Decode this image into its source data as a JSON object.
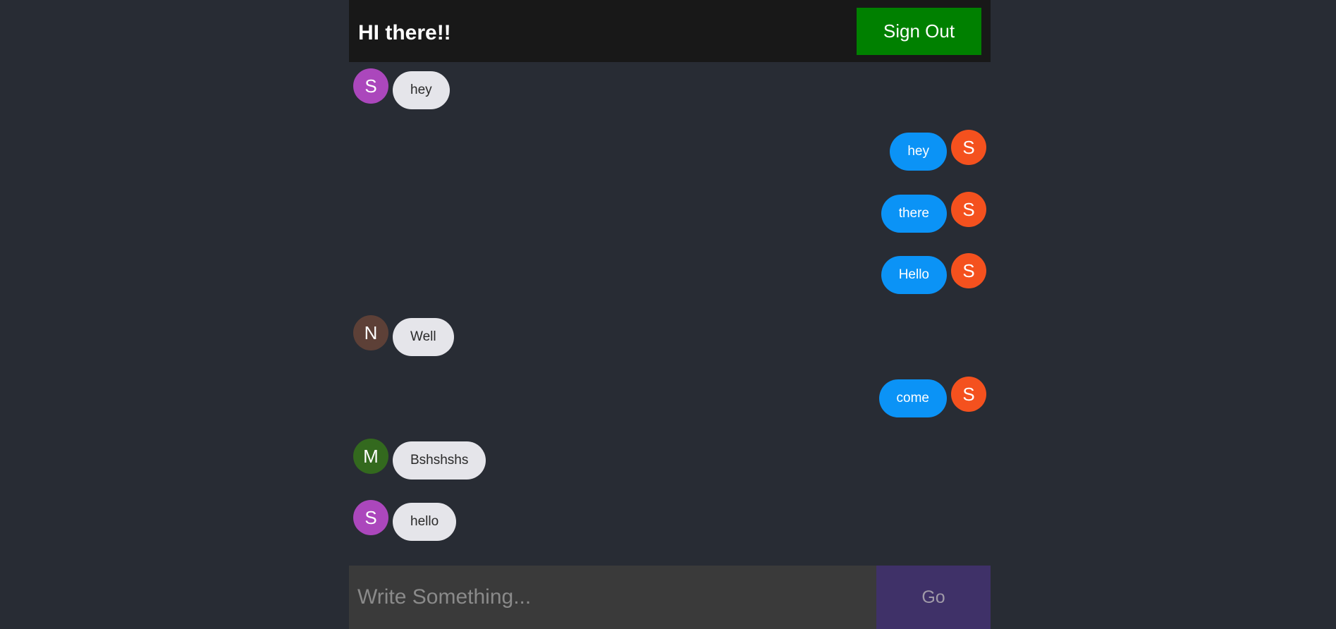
{
  "header": {
    "title": "HI there!!",
    "sign_out_label": "Sign Out"
  },
  "messages": [
    {
      "text": "hey",
      "initial": "S",
      "direction": "received",
      "avatar_color": "#ab47bc"
    },
    {
      "text": "hey",
      "initial": "S",
      "direction": "sent",
      "avatar_color": "#f4511e"
    },
    {
      "text": "there",
      "initial": "S",
      "direction": "sent",
      "avatar_color": "#f4511e"
    },
    {
      "text": "Hello",
      "initial": "S",
      "direction": "sent",
      "avatar_color": "#f4511e"
    },
    {
      "text": "Well",
      "initial": "N",
      "direction": "received",
      "avatar_color": "#5d4037"
    },
    {
      "text": "come",
      "initial": "S",
      "direction": "sent",
      "avatar_color": "#f4511e"
    },
    {
      "text": "Bshshshs",
      "initial": "M",
      "direction": "received",
      "avatar_color": "#33691e"
    },
    {
      "text": "hello",
      "initial": "S",
      "direction": "received",
      "avatar_color": "#ab47bc"
    }
  ],
  "composer": {
    "placeholder": "Write Something...",
    "value": "",
    "send_label": "Go"
  },
  "colors": {
    "background": "#282c34",
    "header_background": "#181818",
    "sign_out_button": "#008000",
    "sent_bubble": "#0b93f6",
    "received_bubble": "#e5e5ea",
    "composer_background": "#3a3a3a",
    "send_button": "#3f3168"
  }
}
